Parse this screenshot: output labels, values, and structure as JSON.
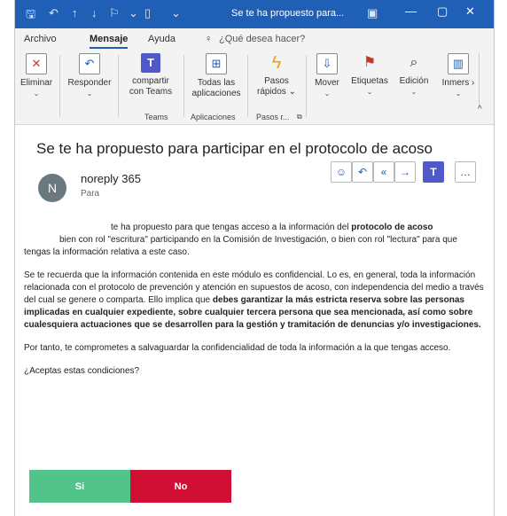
{
  "window": {
    "title": "Se te ha propuesto para..."
  },
  "menu": {
    "tabs": [
      "Archivo",
      "Mensaje",
      "Ayuda"
    ],
    "search_placeholder": "¿Qué desea hacer?"
  },
  "ribbon": {
    "buttons": [
      {
        "label": "Eliminar"
      },
      {
        "label": "Responder"
      },
      {
        "label": "compartir con Teams"
      },
      {
        "label": "Todas las aplicaciones"
      },
      {
        "label": "Pasos rápidos"
      },
      {
        "label": "Mover"
      },
      {
        "label": "Etiquetas"
      },
      {
        "label": "Edición"
      },
      {
        "label": "Inmers"
      }
    ],
    "groups": [
      "Teams",
      "Aplicaciones",
      "Pasos r..."
    ]
  },
  "message": {
    "subject": "Se te ha propuesto para participar en el protocolo de acoso",
    "sender": "noreply 365",
    "avatar_initial": "N",
    "to_label": "Para",
    "p1_a": "te ha propuesto para que tengas acceso a la información del ",
    "p1_b": "protocolo de acoso",
    "p1_c": "bien con rol \"escritura\" participando en la Comisión de Investigación, o bien con rol \"lectura\" para que tengas la información relativa a este caso.",
    "p2_a": "Se te recuerda que la información contenida en este módulo es confidencial. Lo es, en general, toda la información relacionada con el protocolo de prevención y atención en supuestos de acoso, con independencia del medio a través del cual se genere o comparta. Ello implica que ",
    "p2_b": "debes garantizar la más estricta reserva sobre las personas implicadas en cualquier expediente, sobre cualquier tercera persona que sea mencionada, así como sobre cualesquiera actuaciones que se desarrollen para la gestión y tramitación de denuncias y/o investigaciones.",
    "p3": "Por tanto, te comprometes a salvaguardar la confidencialidad de toda la información a la que tengas acceso.",
    "p4": "¿Aceptas estas condiciones?",
    "yes_label": "Si",
    "no_label": "No"
  },
  "colors": {
    "titlebar": "#1f5fb6",
    "yes": "#52c48a",
    "no": "#d10f34"
  }
}
